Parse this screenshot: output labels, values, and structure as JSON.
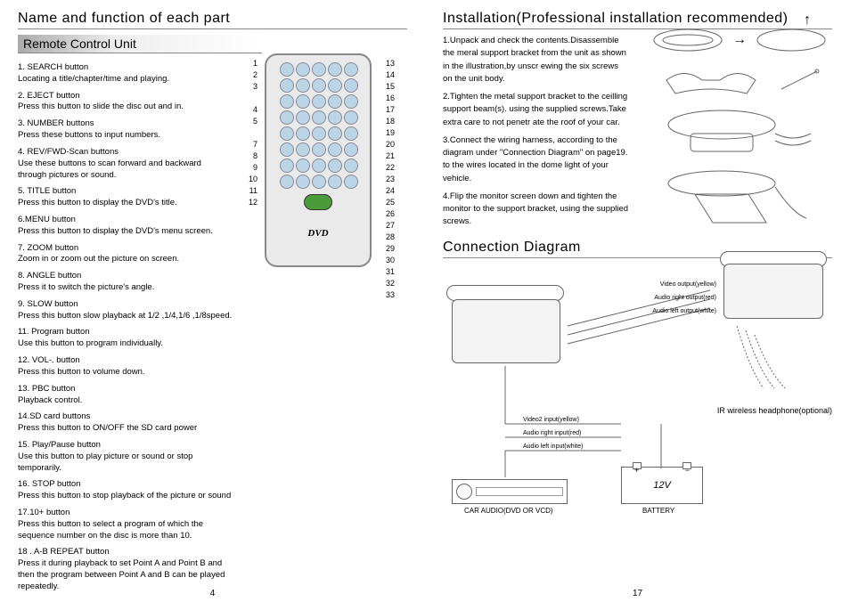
{
  "left": {
    "title": "Name and function of each part",
    "subsection": "Remote Control Unit",
    "page_num": "4",
    "callouts_left": [
      "1",
      "2",
      "3",
      "",
      "4",
      "5",
      "",
      "7",
      "8",
      "9",
      "10",
      "11",
      "12"
    ],
    "callouts_right": [
      "13",
      "14",
      "15",
      "16",
      "17",
      "18",
      "19",
      "20",
      "21",
      "22",
      "23",
      "24",
      "25",
      "26",
      "27",
      "28",
      "29",
      "30",
      "31",
      "32",
      "33"
    ],
    "dvd_logo": "DVD",
    "items": [
      {
        "t": "1. SEARCH button",
        "d": "Locating a title/chapter/time and playing."
      },
      {
        "t": "2. EJECT button",
        "d": "Press this button to slide the disc out and in."
      },
      {
        "t": "3. NUMBER buttons",
        "d": "Press these buttons to input numbers."
      },
      {
        "t": "4. REV/FWD-Scan buttons",
        "d": "Use these buttons to scan forward and backward through pictures or sound."
      },
      {
        "t": "5. TITLE button",
        "d": "Press this button to display the DVD's title."
      },
      {
        "t": "6.MENU button",
        "d": "Press this button to display the DVD's menu screen."
      },
      {
        "t": "7. ZOOM button",
        "d": "Zoom in or zoom out the picture on screen."
      },
      {
        "t": "8. ANGLE button",
        "d": "Press it to switch the picture's angle."
      },
      {
        "t": "9. SLOW button",
        "d": "Press this button slow playback at 1/2 ,1/4,1/6 ,1/8speed."
      },
      {
        "t": "11. Program button",
        "d": "Use this button to program individually."
      },
      {
        "t": "12. VOL-. button",
        "d": "Press this button to volume down."
      },
      {
        "t": "13. PBC button",
        "d": "Playback control."
      },
      {
        "t": "14.SD card  buttons",
        "d": "Press this button to ON/OFF the SD card  power"
      },
      {
        "t": "15. Play/Pause button",
        "d": "Use this button to play picture or sound or stop temporarily."
      },
      {
        "t": "16. STOP button",
        "d": "Press this button to stop playback of the picture or sound"
      },
      {
        "t": "17.10+ button",
        "d": "Press this button to select a program of which the sequence number on the disc is more than 10."
      },
      {
        "t": "18 . A-B REPEAT button",
        "d": "Press it during playback to set Point A and Point B and then the program between Point A and B can be played repeatedly."
      }
    ]
  },
  "right": {
    "title_install": "Installation(Professional installation recommended)",
    "title_conn": "Connection Diagram",
    "page_num": "17",
    "install_steps": [
      "1.Unpack and check the contents.Disassemble the meral support bracket from the unit as shown in the illustration,by unscr ewing the six screws on the unit body.",
      "2.Tighten the metal support bracket to the ceilling support beam(s). using the supplied screws.Take extra care to not penetr ate the roof of your car.",
      "3.Connect the wiring harness, according to the diagram under \"Connection Diagram\" on page19. to the wires located in the dome light of your vehicle.",
      "4.Flip the monitor screen down  and tighten the monitor to the support bracket, using the supplied screws."
    ],
    "wires_right": [
      "Video output(yellow)",
      "Audio right output(red)",
      "Audio left output(white)"
    ],
    "wires_left": [
      "Video2 input(yellow)",
      "Audio right input(red)",
      "Audio left input(white)"
    ],
    "headphone": "IR wireless headphone(optional)",
    "battery_label": "12V",
    "caption_stereo": "CAR AUDIO(DVD OR VCD)",
    "caption_battery": "BATTERY"
  }
}
